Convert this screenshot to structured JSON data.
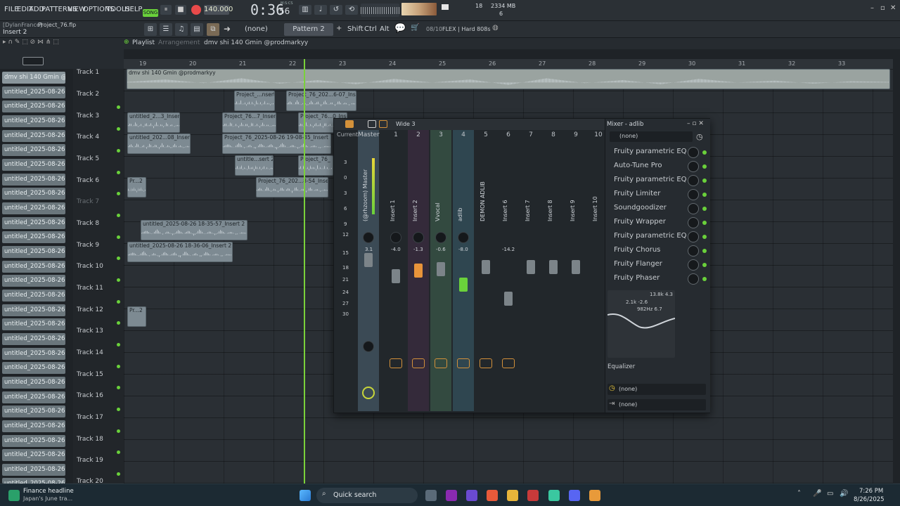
{
  "menu": [
    "FILE",
    "EDIT",
    "ADD",
    "PATTERNS",
    "VIEW",
    "OPTIONS",
    "TOOLS",
    "HELP"
  ],
  "transport": {
    "mode": "SONG",
    "tempo": "140.000",
    "time": "0:36",
    "time_sub": "56",
    "time_unit": "M:S:CS"
  },
  "system": {
    "cpu": "18",
    "memory": "2334 MB",
    "voices": "6"
  },
  "project": {
    "user": "[DylanFrance]",
    "file": "Project_76.flp",
    "insert": "Insert 2"
  },
  "toolbar": {
    "snap": "(none)",
    "pattern": "Pattern 2",
    "shift": "Shift",
    "ctrl": "Ctrl",
    "alt": "Alt",
    "preset_count": "08/10",
    "preset_name": "FLEX | Hard 808s"
  },
  "playlist": {
    "title": "Playlist",
    "subtitle": "Arrangement",
    "pattern_title": "dmv shi 140 Gmin @prodmarkyy"
  },
  "ruler": [
    "19",
    "20",
    "21",
    "22",
    "23",
    "24",
    "25",
    "26",
    "27",
    "28",
    "29",
    "30",
    "31",
    "32",
    "33"
  ],
  "channels": [
    "dmv shi 140 Gmin @...",
    "untitled_2025-08-26 17-...",
    "untitled_2025-08-26 17-...",
    "untitled_2025-08-26 17-...",
    "untitled_2025-08-26 17-...",
    "untitled_2025-08-26 17-...",
    "untitled_2025-08-26 17-...",
    "untitled_2025-08-26 17-...",
    "untitled_2025-08-26 17-...",
    "untitled_2025-08-26 17-...",
    "untitled_2025-08-26 17-...",
    "untitled_2025-08-26 17-...",
    "untitled_2025-08-26 17-...",
    "untitled_2025-08-26 17-...",
    "untitled_2025-08-26 17-...",
    "untitled_2025-08-26 17-...",
    "untitled_2025-08-26 17-...",
    "untitled_2025-08-26 17-...",
    "untitled_2025-08-26 17-...",
    "untitled_2025-08-26 17-...",
    "untitled_2025-08-26 17-...",
    "untitled_2025-08-26 17-...",
    "untitled_2025-08-26 17-...",
    "untitled_2025-08-26 17-...",
    "untitled_2025-08-26 17-...",
    "untitled_2025-08-26 17-...",
    "untitled_2025-08-26 17-...",
    "untitled_2025-08-26 17-...",
    "untitled_2025-08-26 17-..."
  ],
  "tracks": [
    "Track 1",
    "Track 2",
    "Track 3",
    "Track 4",
    "Track 5",
    "Track 6",
    "Track 7",
    "Track 8",
    "Track 9",
    "Track 10",
    "Track 11",
    "Track 12",
    "Track 13",
    "Track 14",
    "Track 15",
    "Track 16",
    "Track 17",
    "Track 18",
    "Track 19",
    "Track 20"
  ],
  "clips": [
    "dmv shi 140 Gmin @prodmarkyy",
    "Project_...nsert 2",
    "Project_76_202...6-07_Insert 2",
    "untitled_2...3_Insert 2",
    "Project_76...7_Insert 2",
    "Project_76...0_Insert 2",
    "untitled_202...08_Insert 2",
    "Project_76_2025-08-26 19-08-35_Insert 2",
    "untitle...sert 2",
    "Project_76_",
    "Pr...2",
    "Project_76_202...8-54_Insert 2",
    "untitled_2025-08-26 18-35-57_Insert 2",
    "untitled_2025-08-26 18-36-06_Insert 2",
    "Pr...2"
  ],
  "mixer": {
    "layout": "Wide 3",
    "current": "Current",
    "strips": [
      {
        "num": "Master",
        "name": "(@rhzoom) Master",
        "vol": "3.1"
      },
      {
        "num": "1",
        "name": "Insert 1",
        "vol": "-4.0"
      },
      {
        "num": "2",
        "name": "Insert 2",
        "vol": "-1.3"
      },
      {
        "num": "3",
        "name": "Vvocal",
        "vol": "-0.6"
      },
      {
        "num": "4",
        "name": "adlib",
        "vol": "-8.0"
      },
      {
        "num": "5",
        "name": "DEMON ADLIB",
        "vol": ""
      },
      {
        "num": "6",
        "name": "Insert 6",
        "vol": "-14.2"
      },
      {
        "num": "7",
        "name": "Insert 7",
        "vol": ""
      },
      {
        "num": "8",
        "name": "Insert 8",
        "vol": ""
      },
      {
        "num": "9",
        "name": "Insert 9",
        "vol": ""
      },
      {
        "num": "10",
        "name": "Insert 10",
        "vol": ""
      }
    ],
    "db_scale": [
      "3",
      "0",
      "3",
      "6",
      "9",
      "12",
      "15",
      "18",
      "21",
      "24",
      "27",
      "30"
    ],
    "panel_title": "Mixer - adlib",
    "input": "(none)",
    "fx": [
      "Fruity parametric EQ 2",
      "Auto-Tune Pro",
      "Fruity parametric EQ 2",
      "Fruity Limiter",
      "Soundgoodizer",
      "Fruity Wrapper",
      "Fruity parametric EQ 2",
      "Fruity Chorus",
      "Fruity Flanger",
      "Fruity Phaser"
    ],
    "eq_labels": [
      "13.8k 4.3",
      "2.1k -2.6",
      "982Hz 6.7"
    ],
    "eq_title": "Equalizer",
    "out1": "(none)",
    "out2": "(none)"
  },
  "taskbar": {
    "news_title": "Finance headline",
    "news_sub": "Japan's June tra...",
    "search": "Quick search",
    "time": "7:26 PM",
    "date": "8/26/2025"
  }
}
